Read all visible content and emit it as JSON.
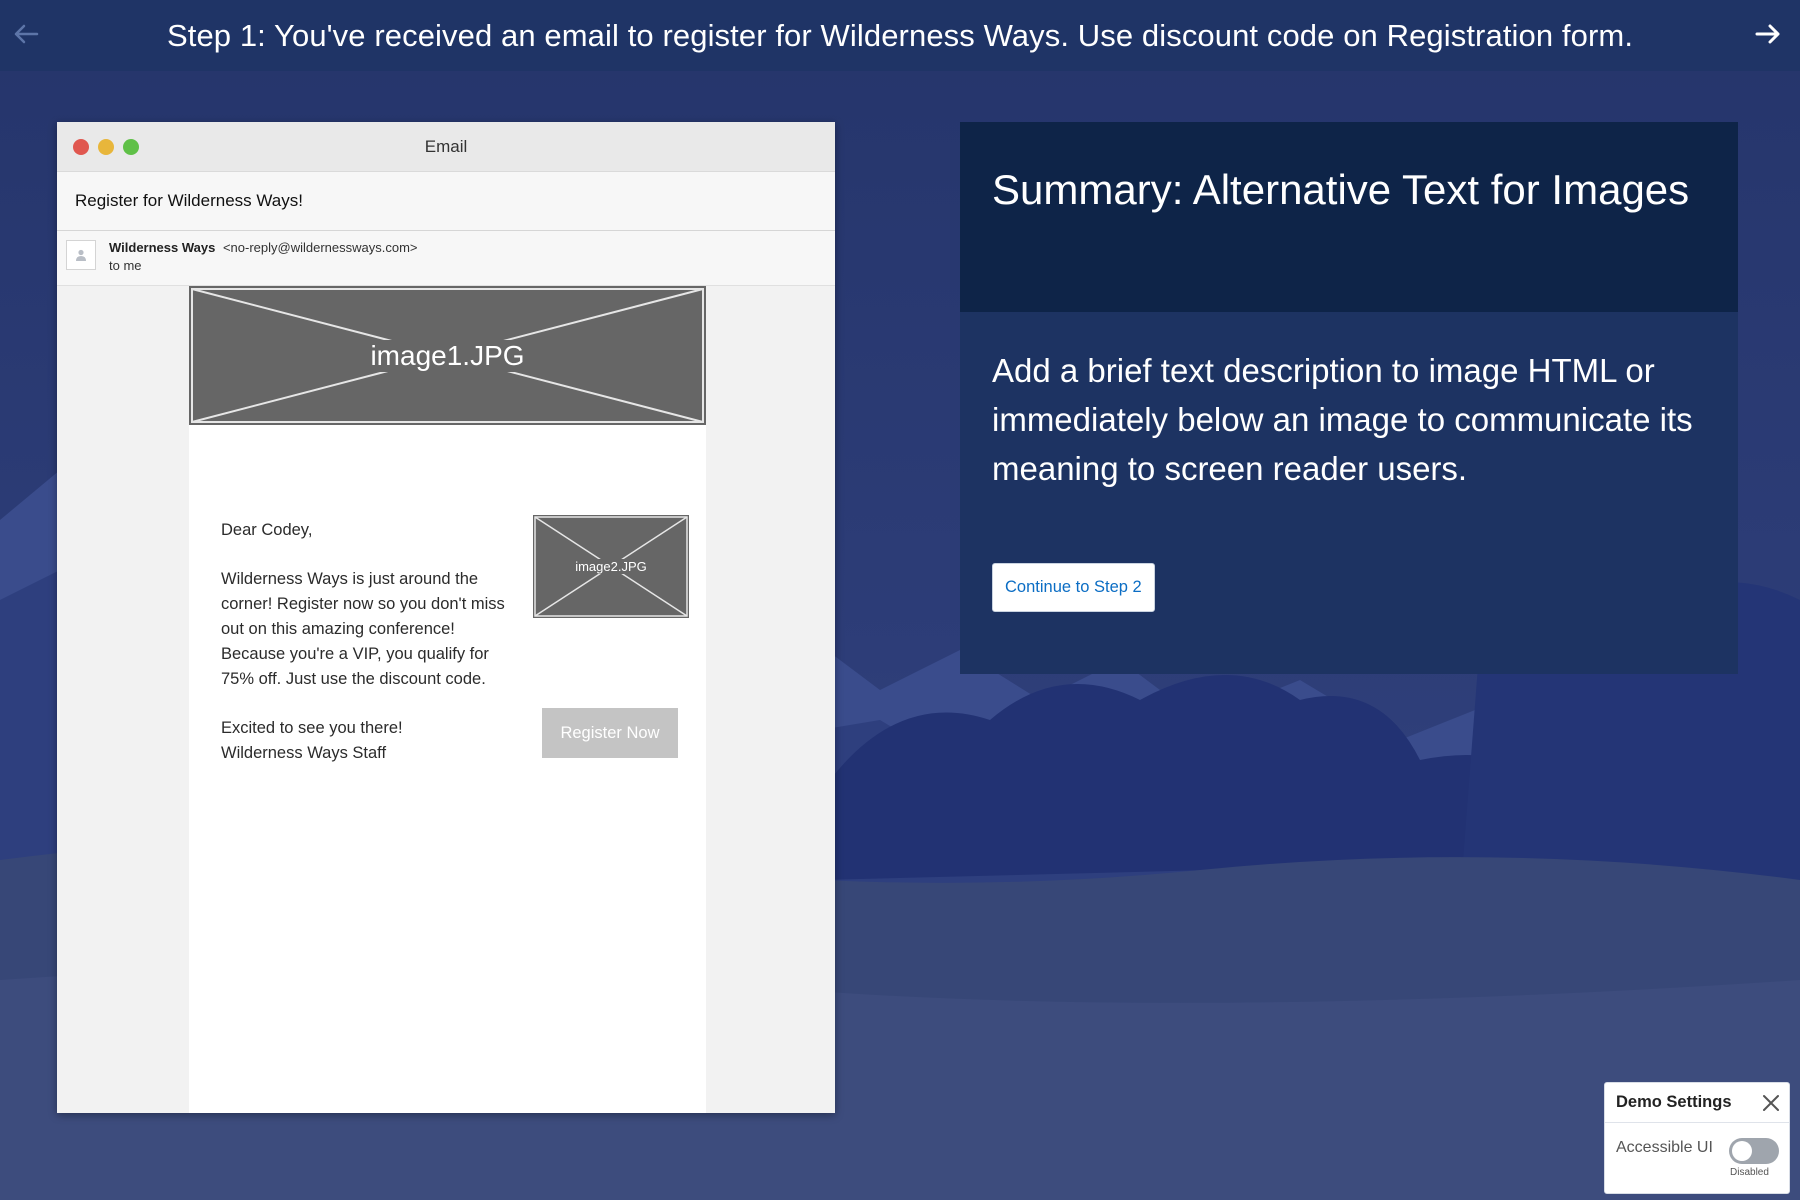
{
  "topbar": {
    "step_text": "Step 1: You've received an email to register for Wilderness Ways. Use discount code on Registration form.",
    "prev_icon": "arrow-left-icon",
    "next_icon": "arrow-right-icon"
  },
  "email_window": {
    "title": "Email",
    "subject": "Register for Wilderness Ways!",
    "sender_name": "Wilderness Ways",
    "sender_email": "<no-reply@wildernessways.com>",
    "to_line": "to me",
    "image1_label": "image1.JPG",
    "image2_label": "image2.JPG",
    "greeting": "Dear Codey,",
    "body_paragraph": "Wilderness Ways is just around the corner! Register now so you don't miss out on this amazing conference! Because you're a VIP, you qualify for 75% off. Just use the discount code.",
    "signoff": "Excited to see you there!",
    "signature": "Wilderness Ways Staff",
    "register_button": "Register Now"
  },
  "summary": {
    "title": "Summary: Alternative Text for Images",
    "text": "Add a brief text description to image HTML or immediately below an image to communicate its meaning to screen reader users.",
    "continue_button": "Continue to Step 2"
  },
  "demo_settings": {
    "title": "Demo Settings",
    "toggle_label": "Accessible UI",
    "toggle_state": "Disabled",
    "toggle_on": false
  },
  "colors": {
    "topbar": "#1f3466",
    "summary_header": "#0e2448",
    "summary_body": "#1d3362",
    "link_blue": "#0b6dc4",
    "dot_red": "#e0574f",
    "dot_yellow": "#e8b63b",
    "dot_green": "#5fc047"
  }
}
